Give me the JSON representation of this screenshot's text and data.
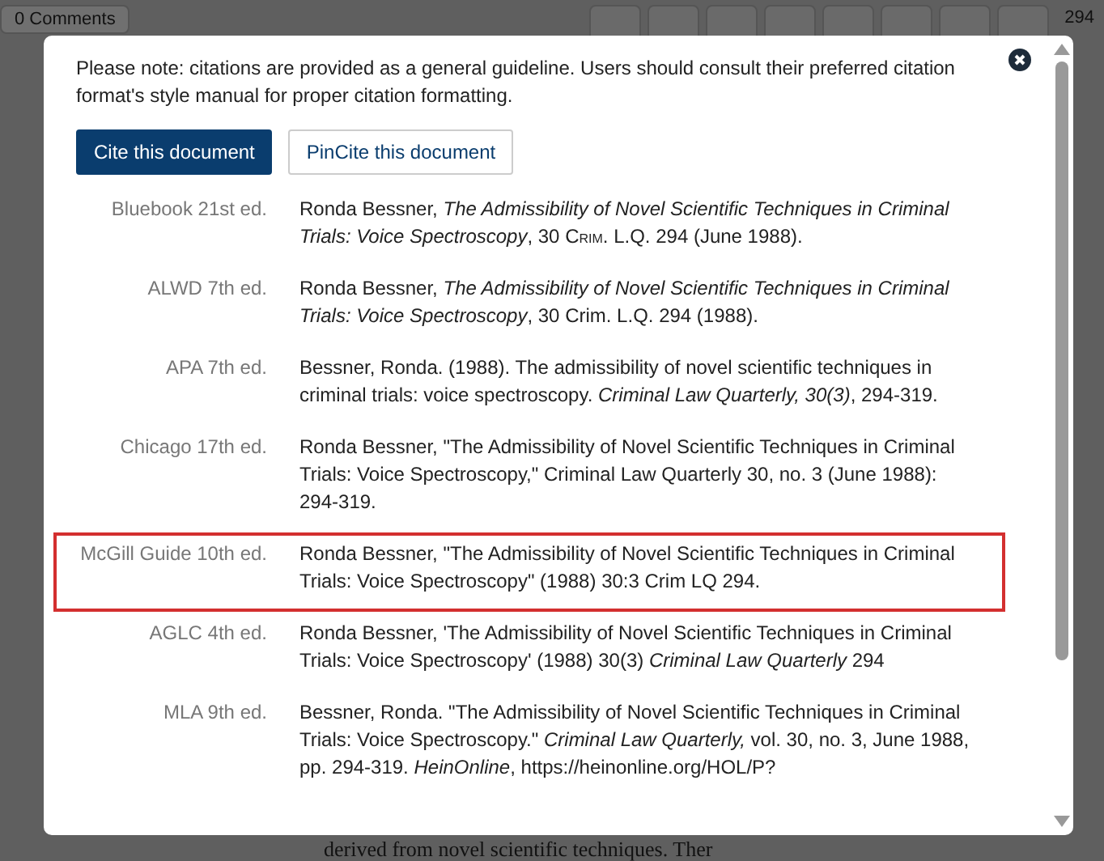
{
  "background": {
    "comments_button": "0 Comments",
    "page_number": "294",
    "body_text": "derived from novel scientific techniques. Ther"
  },
  "modal": {
    "note": "Please note: citations are provided as a general guideline. Users should consult their preferred citation format's style manual for proper citation formatting.",
    "tabs": [
      {
        "label": "Cite this document",
        "selected": true
      },
      {
        "label": "PinCite this document",
        "selected": false
      }
    ],
    "citations": [
      {
        "style": "Bluebook 21st ed.",
        "highlighted": false,
        "parts": [
          {
            "text": "Ronda Bessner, ",
            "kind": "plain"
          },
          {
            "text": "The Admissibility of Novel Scientific Techniques in Criminal Trials: Voice Spectroscopy",
            "kind": "italic"
          },
          {
            "text": ", 30 ",
            "kind": "plain"
          },
          {
            "text": "Crim.",
            "kind": "smallcaps"
          },
          {
            "text": " L.Q. 294 (June 1988).",
            "kind": "plain"
          }
        ]
      },
      {
        "style": "ALWD 7th ed.",
        "highlighted": false,
        "parts": [
          {
            "text": "Ronda Bessner, ",
            "kind": "plain"
          },
          {
            "text": "The Admissibility of Novel Scientific Techniques in Criminal Trials: Voice Spectroscopy",
            "kind": "italic"
          },
          {
            "text": ", 30 Crim. L.Q. 294 (1988).",
            "kind": "plain"
          }
        ]
      },
      {
        "style": "APA 7th ed.",
        "highlighted": false,
        "parts": [
          {
            "text": "Bessner, Ronda. (1988). The admissibility of novel scientific techniques in criminal trials: voice spectroscopy. ",
            "kind": "plain"
          },
          {
            "text": "Criminal Law Quarterly, 30(3)",
            "kind": "italic"
          },
          {
            "text": ", 294-319.",
            "kind": "plain"
          }
        ]
      },
      {
        "style": "Chicago 17th ed.",
        "highlighted": false,
        "parts": [
          {
            "text": "Ronda Bessner, \"The Admissibility of Novel Scientific Techniques in Criminal Trials: Voice Spectroscopy,\" Criminal Law Quarterly 30, no. 3 (June 1988): 294-319.",
            "kind": "plain"
          }
        ]
      },
      {
        "style": "McGill Guide 10th ed.",
        "highlighted": true,
        "parts": [
          {
            "text": "Ronda Bessner, \"The Admissibility of Novel Scientific Techniques in Criminal Trials: Voice Spectroscopy\" (1988) 30:3 Crim LQ 294.",
            "kind": "plain"
          }
        ]
      },
      {
        "style": "AGLC 4th ed.",
        "highlighted": false,
        "parts": [
          {
            "text": "Ronda Bessner, 'The Admissibility of Novel Scientific Techniques in Criminal Trials: Voice Spectroscopy' (1988) 30(3) ",
            "kind": "plain"
          },
          {
            "text": "Criminal Law Quarterly",
            "kind": "italic"
          },
          {
            "text": " 294",
            "kind": "plain"
          }
        ]
      },
      {
        "style": "MLA 9th ed.",
        "highlighted": false,
        "parts": [
          {
            "text": "Bessner, Ronda. \"The Admissibility of Novel Scientific Techniques in Criminal Trials: Voice Spectroscopy.\" ",
            "kind": "plain"
          },
          {
            "text": "Criminal Law Quarterly,",
            "kind": "italic"
          },
          {
            "text": " vol. 30, no. 3, June 1988, pp. 294-319. ",
            "kind": "plain"
          },
          {
            "text": "HeinOnline",
            "kind": "italic"
          },
          {
            "text": ", https://heinonline.org/HOL/P?",
            "kind": "plain"
          }
        ]
      }
    ]
  }
}
